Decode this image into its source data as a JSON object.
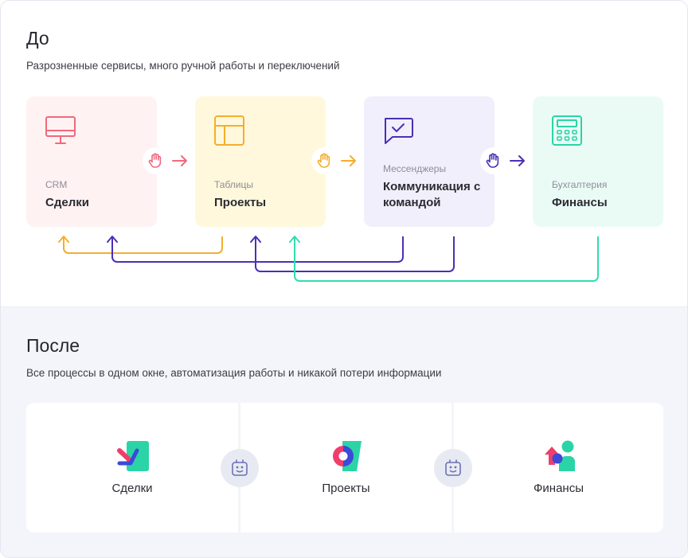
{
  "before": {
    "title": "До",
    "subtitle": "Разрозненные сервисы, много ручной работы и переключений",
    "cards": [
      {
        "category": "CRM",
        "title": "Сделки",
        "icon": "monitor-icon",
        "bg": "#fff2f3",
        "color": "#ef6a7e"
      },
      {
        "category": "Таблицы",
        "title": "Проекты",
        "icon": "table-icon",
        "bg": "#fff8dc",
        "color": "#f4ae2d"
      },
      {
        "category": "Мессенджеры",
        "title": "Коммуникация с командой",
        "icon": "chat-icon",
        "bg": "#f0effb",
        "color": "#4c2fb5"
      },
      {
        "category": "Бухгалтерия",
        "title": "Финансы",
        "icon": "calculator-icon",
        "bg": "#eafbf5",
        "color": "#2bd4a6"
      }
    ],
    "handoff_colors": [
      "#ef6a7e",
      "#f4ae2d",
      "#4c2fb5"
    ],
    "link_colors": {
      "orange": "#f4ae2d",
      "purple": "#4c2fb5",
      "teal": "#32dcb0"
    }
  },
  "after": {
    "title": "После",
    "subtitle": "Все процессы в одном окне, автоматизация работы и никакой потери информации",
    "panels": [
      {
        "label": "Сделки",
        "icon": "deals-logo-icon"
      },
      {
        "label": "Проекты",
        "icon": "projects-logo-icon"
      },
      {
        "label": "Финансы",
        "icon": "finance-logo-icon"
      }
    ],
    "connector_icon": "robot-icon"
  }
}
